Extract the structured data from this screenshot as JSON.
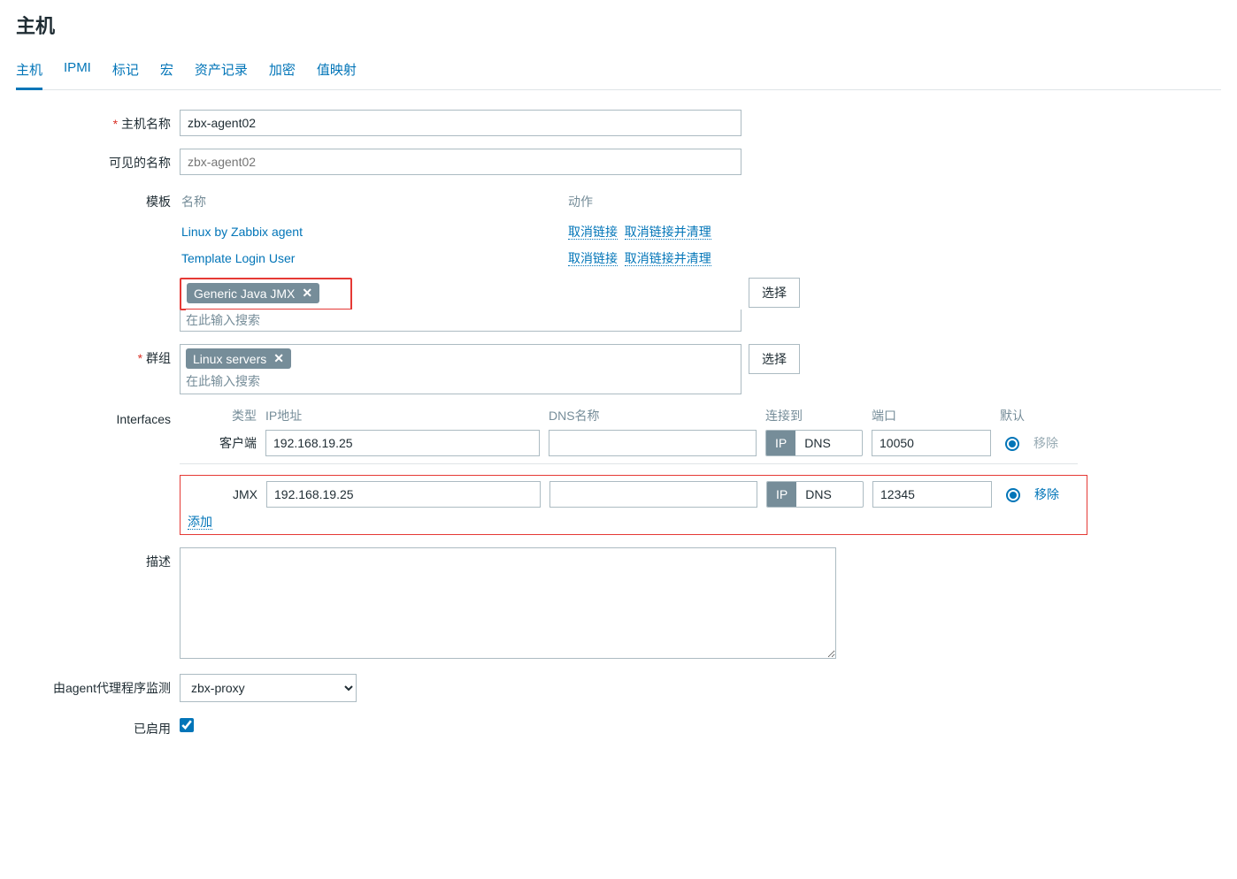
{
  "page": {
    "title": "主机"
  },
  "tabs": {
    "host": "主机",
    "ipmi": "IPMI",
    "tags": "标记",
    "macros": "宏",
    "inventory": "资产记录",
    "encryption": "加密",
    "valuemap": "值映射"
  },
  "labels": {
    "hostname": "主机名称",
    "visiblename": "可见的名称",
    "templates": "模板",
    "groups": "群组",
    "interfaces": "Interfaces",
    "description": "描述",
    "proxy": "由agent代理程序监测",
    "enabled": "已启用"
  },
  "hostname": {
    "value": "zbx-agent02"
  },
  "visiblename": {
    "placeholder": "zbx-agent02"
  },
  "templates": {
    "header_name": "名称",
    "header_action": "动作",
    "rows": [
      {
        "name": "Linux by Zabbix agent",
        "unlink": "取消链接",
        "unlink_clear": "取消链接并清理"
      },
      {
        "name": "Template Login User",
        "unlink": "取消链接",
        "unlink_clear": "取消链接并清理"
      }
    ],
    "new_tag": "Generic Java JMX",
    "search_placeholder": "在此输入搜索",
    "select_btn": "选择"
  },
  "groups": {
    "tag": "Linux servers",
    "search_placeholder": "在此输入搜索",
    "select_btn": "选择"
  },
  "interfaces": {
    "header": {
      "type": "类型",
      "ip": "IP地址",
      "dns": "DNS名称",
      "connect": "连接到",
      "port": "端口",
      "default": "默认"
    },
    "agent": {
      "type": "客户端",
      "ip": "192.168.19.25",
      "dns": "",
      "ip_btn": "IP",
      "dns_btn": "DNS",
      "port": "10050",
      "remove": "移除"
    },
    "jmx": {
      "type": "JMX",
      "ip": "192.168.19.25",
      "dns": "",
      "ip_btn": "IP",
      "dns_btn": "DNS",
      "port": "12345",
      "remove": "移除"
    },
    "add": "添加"
  },
  "description": {
    "value": ""
  },
  "proxy": {
    "selected": "zbx-proxy"
  },
  "enabled": {
    "checked": true
  }
}
